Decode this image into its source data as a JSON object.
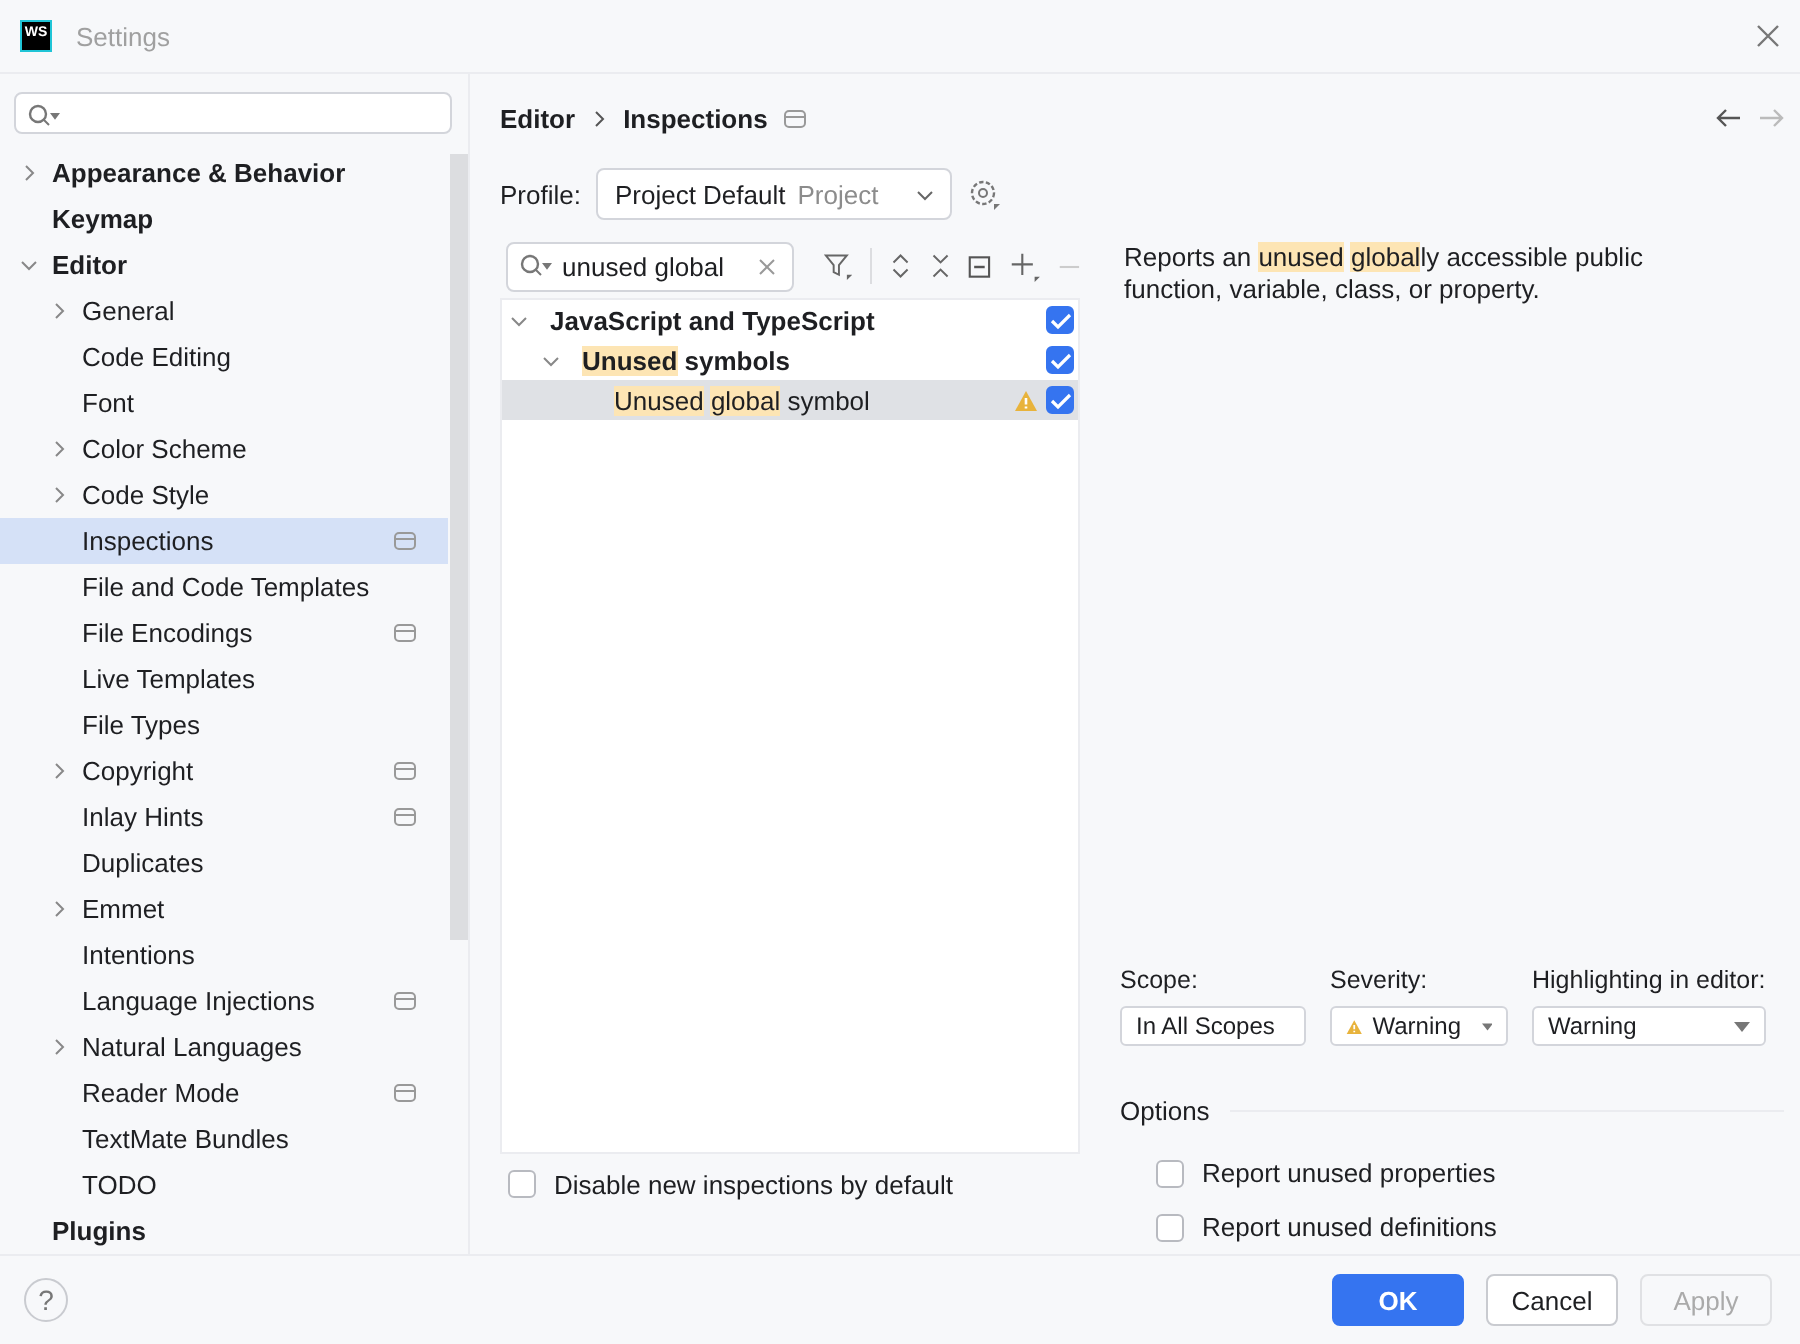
{
  "window": {
    "title": "Settings",
    "logo": "WS"
  },
  "sidebar": {
    "items": [
      {
        "label": "Appearance & Behavior",
        "expanded": false,
        "selected": false
      },
      {
        "label": "Keymap",
        "selected": false
      },
      {
        "label": "Editor",
        "expanded": true,
        "selected": false,
        "children": [
          {
            "label": "General",
            "expanded": false,
            "selected": false,
            "scoped": false
          },
          {
            "label": "Code Editing",
            "selected": false,
            "scoped": false
          },
          {
            "label": "Font",
            "selected": false,
            "scoped": false
          },
          {
            "label": "Color Scheme",
            "expanded": false,
            "selected": false,
            "scoped": false
          },
          {
            "label": "Code Style",
            "expanded": false,
            "selected": false,
            "scoped": false
          },
          {
            "label": "Inspections",
            "selected": true,
            "scoped": true
          },
          {
            "label": "File and Code Templates",
            "selected": false,
            "scoped": false
          },
          {
            "label": "File Encodings",
            "selected": false,
            "scoped": true
          },
          {
            "label": "Live Templates",
            "selected": false,
            "scoped": false
          },
          {
            "label": "File Types",
            "selected": false,
            "scoped": false
          },
          {
            "label": "Copyright",
            "expanded": false,
            "selected": false,
            "scoped": true
          },
          {
            "label": "Inlay Hints",
            "selected": false,
            "scoped": true
          },
          {
            "label": "Duplicates",
            "selected": false,
            "scoped": false
          },
          {
            "label": "Emmet",
            "expanded": false,
            "selected": false,
            "scoped": false
          },
          {
            "label": "Intentions",
            "selected": false,
            "scoped": false
          },
          {
            "label": "Language Injections",
            "selected": false,
            "scoped": true
          },
          {
            "label": "Natural Languages",
            "expanded": false,
            "selected": false,
            "scoped": false
          },
          {
            "label": "Reader Mode",
            "selected": false,
            "scoped": true
          },
          {
            "label": "TextMate Bundles",
            "selected": false,
            "scoped": false
          },
          {
            "label": "TODO",
            "selected": false,
            "scoped": false
          }
        ]
      },
      {
        "label": "Plugins",
        "selected": false
      }
    ]
  },
  "breadcrumb": [
    "Editor",
    "Inspections"
  ],
  "profile": {
    "label": "Profile:",
    "name": "Project Default",
    "scope": "Project"
  },
  "filter": {
    "value": "unused global"
  },
  "tree": [
    {
      "segments": [
        {
          "text": "JavaScript and TypeScript",
          "match": false
        }
      ],
      "expanded": true,
      "checked": true,
      "selected": false,
      "warning": false,
      "children": [
        {
          "segments": [
            {
              "text": "Unused",
              "match": true
            },
            {
              "text": " symbols",
              "match": false
            }
          ],
          "expanded": true,
          "checked": true,
          "selected": false,
          "warning": false,
          "children": [
            {
              "segments": [
                {
                  "text": "Unused global",
                  "match": true
                },
                {
                  "text": " symbol",
                  "match": false
                }
              ],
              "checked": true,
              "selected": true,
              "warning": true
            }
          ]
        }
      ]
    }
  ],
  "description": [
    {
      "text": "Reports an ",
      "match": false
    },
    {
      "text": "unused global",
      "match": true
    },
    {
      "text": "ly accessible public function, variable, class, or property.",
      "match": false
    }
  ],
  "settings": [
    {
      "label": "Scope:",
      "value": "In All Scopes",
      "warning": false
    },
    {
      "label": "Severity:",
      "value": "Warning",
      "warning": true
    },
    {
      "label": "Highlighting in editor:",
      "value": "Warning",
      "warning": false
    }
  ],
  "options": {
    "title": "Options",
    "items": [
      {
        "label": "Report unused properties",
        "checked": false
      },
      {
        "label": "Report unused definitions",
        "checked": false
      }
    ]
  },
  "disable_new": {
    "label": "Disable new inspections by default",
    "checked": false
  },
  "footer": {
    "help": "?",
    "buttons": [
      {
        "label": "OK",
        "kind": "primary",
        "disabled": false
      },
      {
        "label": "Cancel",
        "kind": "normal",
        "disabled": false
      },
      {
        "label": "Apply",
        "kind": "normal",
        "disabled": true
      }
    ]
  }
}
